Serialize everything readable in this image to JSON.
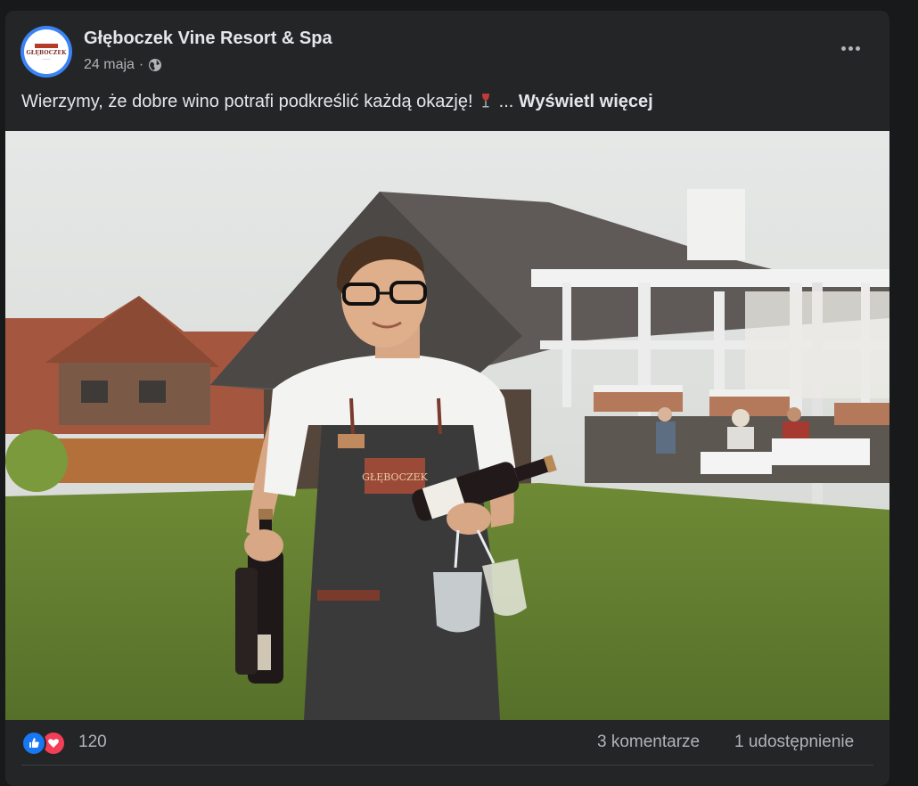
{
  "post": {
    "page_name": "Głęboczek Vine Resort & Spa",
    "date": "24 maja",
    "separator": "·",
    "audience_icon": "globe-icon",
    "more_icon": "more-options-icon",
    "text": "Wierzymy, że dobre wino potrafi podkreślić każdą okazję!",
    "text_emoji": "wine-glass-icon",
    "ellipsis": "...",
    "see_more": "Wyświetl więcej",
    "avatar_logo_text": "GŁĘBOCZEK",
    "apron_patch_text": "GŁĘBOCZEK"
  },
  "photo": {
    "subject": "photo of waiter with wine bottles and glasses in front of resort"
  },
  "footer": {
    "reaction_icons": [
      "like-icon",
      "love-icon"
    ],
    "reaction_count": "120",
    "comments": "3 komentarze",
    "shares": "1 udostępnienie"
  },
  "colors": {
    "background": "#18191a",
    "card": "#242526",
    "text_primary": "#e4e6eb",
    "text_secondary": "#b0b3b8",
    "like_blue": "#1877f2",
    "love_red": "#f33e58"
  }
}
